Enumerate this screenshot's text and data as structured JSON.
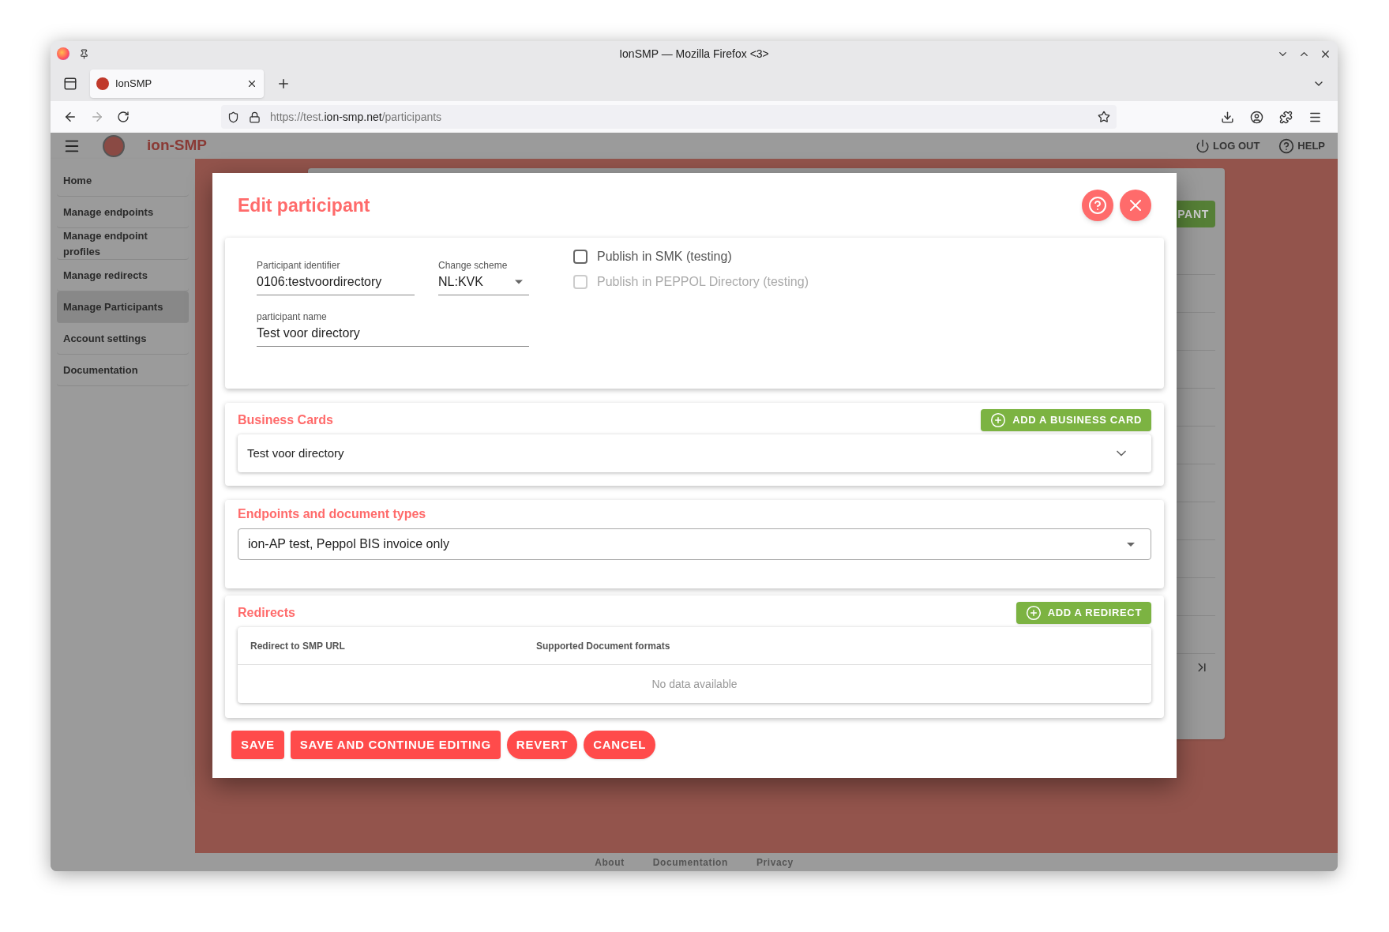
{
  "window": {
    "title": "IonSMP — Mozilla Firefox <3>"
  },
  "browser": {
    "tabs": [
      {
        "label": "IonSMP",
        "selected": true
      }
    ],
    "url": {
      "before": "https://test.",
      "domain": "ion-smp.net",
      "after": "/participants"
    }
  },
  "app_bar": {
    "brand": "ion-SMP",
    "actions": [
      {
        "kind": "logout",
        "label": "LOG OUT"
      },
      {
        "kind": "help",
        "label": "HELP"
      }
    ]
  },
  "sidebar": {
    "items": [
      {
        "label": "Home",
        "selected": false
      },
      {
        "label": "Manage endpoints",
        "selected": false
      },
      {
        "label": "Manage endpoint profiles",
        "selected": false
      },
      {
        "label": "Manage redirects",
        "selected": false
      },
      {
        "label": "Manage Participants",
        "selected": true
      },
      {
        "label": "Account settings",
        "selected": false
      },
      {
        "label": "Documentation",
        "selected": false
      }
    ]
  },
  "background": {
    "button": "PANT"
  },
  "dialog": {
    "title": "Edit participant",
    "fields": [
      {
        "label": "Participant identifier",
        "value": "0106:testvoordirectory",
        "kind": "text"
      },
      {
        "label": "Change scheme",
        "value": "NL:KVK",
        "kind": "select"
      },
      {
        "label": "participant name",
        "value": "Test voor directory",
        "kind": "text"
      }
    ],
    "checkboxes": [
      {
        "label": "Publish in SMK (testing)",
        "checked": false,
        "disabled": false
      },
      {
        "label": "Publish in PEPPOL Directory (testing)",
        "checked": false,
        "disabled": true
      }
    ],
    "business_cards": {
      "title": "Business Cards",
      "add_button": "ADD A BUSINESS CARD",
      "items": [
        {
          "label": "Test voor directory",
          "expanded": false
        }
      ]
    },
    "endpoints": {
      "title": "Endpoints and document types",
      "value": "ion-AP test, Peppol BIS invoice only"
    },
    "redirects": {
      "title": "Redirects",
      "add_button": "ADD A REDIRECT",
      "columns": [
        "Redirect to SMP URL",
        "Supported Document formats"
      ],
      "empty_text": "No data available"
    },
    "buttons": [
      {
        "label": "SAVE",
        "kind": "square"
      },
      {
        "label": "SAVE AND CONTINUE EDITING",
        "kind": "square"
      },
      {
        "label": "REVERT",
        "kind": "pill"
      },
      {
        "label": "CANCEL",
        "kind": "pill"
      }
    ]
  },
  "footer": {
    "links": [
      "About",
      "Documentation",
      "Privacy"
    ]
  }
}
